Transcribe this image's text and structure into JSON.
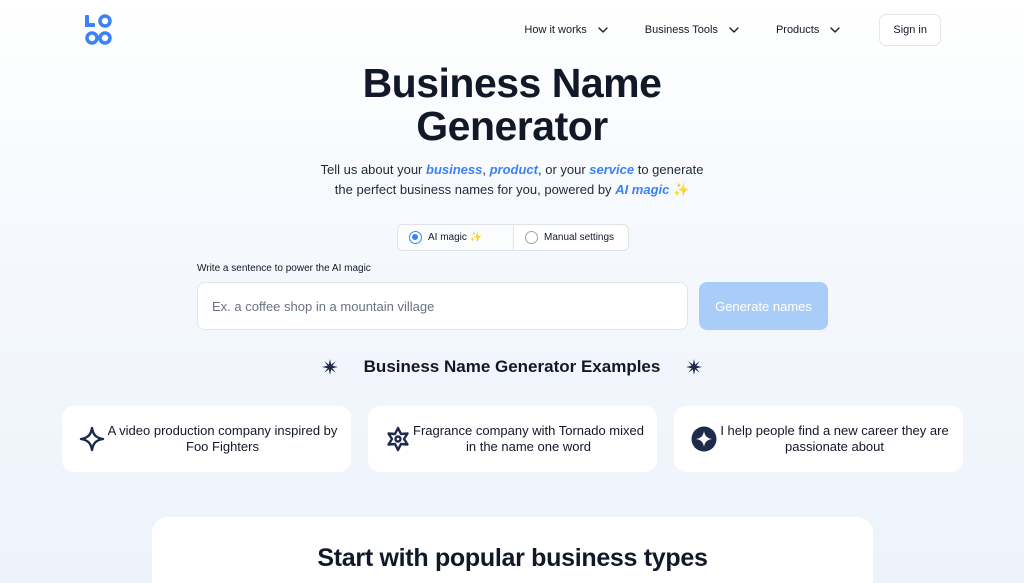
{
  "header": {
    "logo_icon": "logo-mark",
    "nav": [
      {
        "label": "How it works"
      },
      {
        "label": "Business Tools"
      },
      {
        "label": "Products"
      }
    ],
    "signin_label": "Sign in"
  },
  "hero": {
    "title_line1": "Business Name",
    "title_line2": "Generator",
    "sub": {
      "t1": "Tell us about your ",
      "h1": "business",
      "t2": ", ",
      "h2": "product",
      "t3": ", or your ",
      "h3": "service",
      "t4": " to generate",
      "t5": "the perfect business names for you, powered by ",
      "h4": "AI magic",
      "spark": "✨"
    }
  },
  "modes": {
    "ai_label": "AI magic",
    "ai_spark": "✨",
    "manual_label": "Manual settings",
    "selected": "AI magic"
  },
  "prompt": {
    "label": "Write a sentence to power the AI magic",
    "placeholder": "Ex. a coffee shop in a mountain village",
    "value": "",
    "button_label": "Generate names"
  },
  "examples": {
    "heading": "Business Name Generator Examples",
    "items": [
      {
        "text": "A video production company inspired by Foo Fighters",
        "icon": "four-point-star-icon"
      },
      {
        "text": "Fragrance company with Tornado mixed in the name one word",
        "icon": "snowflake-star-icon"
      },
      {
        "text": "I help people find a new career they are passionate about",
        "icon": "star-badge-icon"
      }
    ]
  },
  "popular": {
    "title": "Start with popular business types"
  },
  "colors": {
    "accent": "#3b82f6",
    "button_disabled": "#a9cdf8",
    "icon_dark": "#1e2a4a",
    "text": "#111827"
  }
}
